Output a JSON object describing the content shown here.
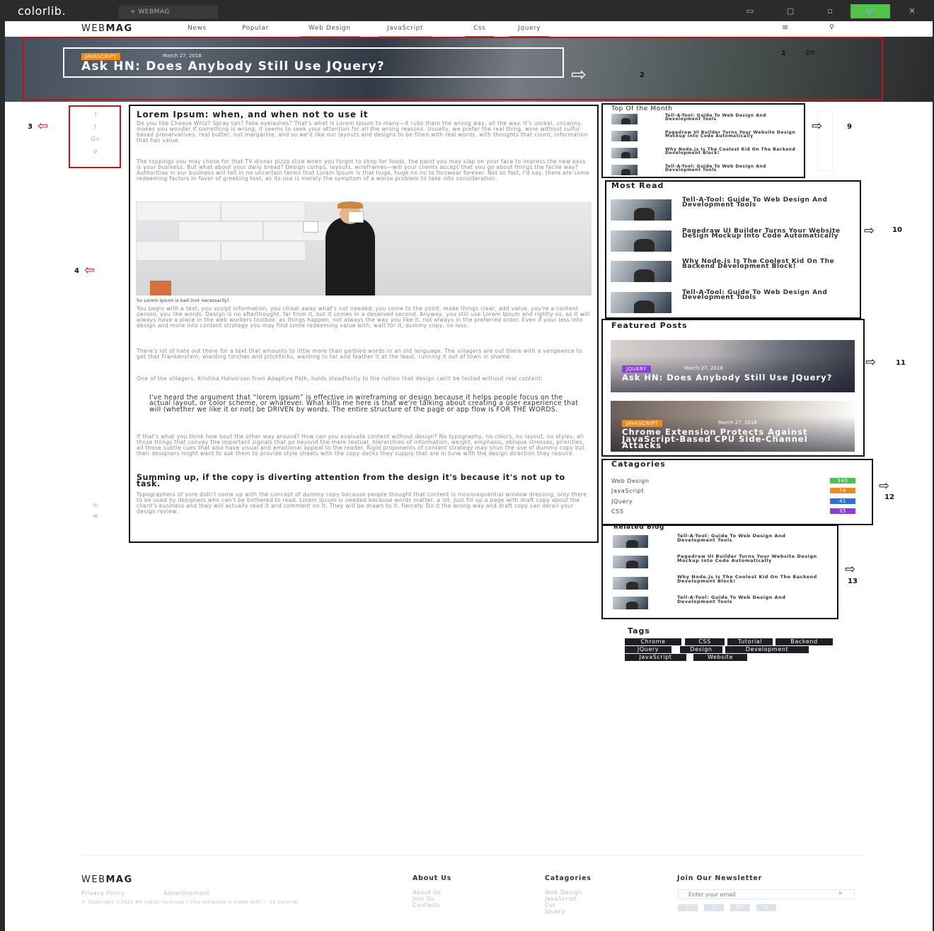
{
  "topbar": {
    "logo": "colorlib.",
    "template_tab": "+  WEBMAG"
  },
  "nav": {
    "brand_thin": "WEB",
    "brand_bold": "MAG",
    "items": [
      {
        "label": "News",
        "color": "#ffffff"
      },
      {
        "label": "Popular",
        "color": "#ffffff"
      },
      {
        "label": "Web Design",
        "color": "#4bbf5b"
      },
      {
        "label": "JavaScript",
        "color": "#f08a1c"
      },
      {
        "label": "Css",
        "color": "#8b3fd9"
      },
      {
        "label": "Jquery",
        "color": "#8b3fd9"
      }
    ]
  },
  "hero": {
    "badge": "JAVASCRIPT",
    "date": "March 27, 2018",
    "title": "Ask HN: Does Anybody Still Use JQuery?"
  },
  "callouts": [
    "1",
    "2",
    "3",
    "4",
    "9",
    "10",
    "11",
    "12",
    "13"
  ],
  "social_labels": [
    "f",
    "t",
    "G+",
    "p",
    "in",
    "✉"
  ],
  "article": {
    "title": "Lorem Ipsum: when, and when not to use it",
    "p1": "Do you like Cheese Whiz? Spray tan? Fake eyelashes? That's what is Lorem Ipsum to many—it rubs them the wrong way, all the way. It's unreal, uncanny, makes you wonder if something is wrong, it seems to seek your attention for all the wrong reasons. Usually, we prefer the real thing, wine without sulfur based preservatives, real butter, not margarine, and so we'd like our layouts and designs to be filled with real words, with thoughts that count, information that has value.",
    "p2": "The toppings you may chose for that TV dinner pizza slice when you forgot to shop for foods, the paint you may slap on your face to impress the new boss is your business. But what about your daily bread? Design comps, layouts, wireframes—will your clients accept that you go about things the facile way? Authorities in our business will tell in no uncertain terms that Lorem Ipsum is that huge, huge no no to forswear forever. Not so fast, I'd say, there are some redeeming factors in favor of greeking text, as its use is merely the symptom of a worse problem to take into consideration.",
    "caption": "So Lorem Ipsum is bad (not necessarily)",
    "p3": "You begin with a text, you sculpt information, you chisel away what's not needed, you come to the point, make things clear, add value, you're a content person, you like words. Design is no afterthought, far from it, but it comes in a deserved second. Anyway, you still use Lorem Ipsum and rightly so, as it will always have a place in the web workers toolbox, as things happen, not always the way you like it, not always in the preferred order. Even if your less into design and more into content strategy you may find some redeeming value with, wait for it, dummy copy, no less.",
    "p4": "There's lot of hate out there for a text that amounts to little more than garbled words in an old language. The villagers are out there with a vengeance to get that Frankenstein, wielding torches and pitchforks, wanting to tar and feather it at the least, running it out of town in shame.",
    "p5": "One of the villagers, Kristina Halvorson from Adaptive Path, holds steadfastly to the notion that design can't be tested without real content:",
    "quote": "I've heard the argument that “lorem ipsum” is effective in wireframing or design because it helps people focus on the actual layout, or color scheme, or whatever. What kills me here is that we're talking about creating a user experience that will (whether we like it or not) be DRIVEN by words. The entire structure of the page or app flow is FOR THE WORDS.",
    "p6": "If that's what you think how bout the other way around? How can you evaluate content without design? No typography, no colors, no layout, no styles, all those things that convey the important signals that go beyond the mere textual, hierarchies of information, weight, emphasis, oblique stresses, priorities, all those subtle cues that also have visual and emotional appeal to the reader. Rigid proponents of content strategy may shun the use of dummy copy but then designers might want to ask them to provide style sheets with the copy decks they supply that are in tune with the design direction they require.",
    "h2": "Summing up, if the copy is diverting attention from the design it's because it's not up to task.",
    "p7": "Typographers of yore didn't come up with the concept of dummy copy because people thought that content is inconsequential window dressing, only there to be used by designers who can't be bothered to read. Lorem Ipsum is needed because words matter, a lot. Just fill up a page with draft copy about the client's business and they will actually read it and comment on it. They will be drawn to it, fiercely. Do it the wrong way and draft copy can derail your design review."
  },
  "top_month": {
    "title": "Top Of the Month",
    "items": [
      "Tell-A-Tool: Guide To Web Design And Development Tools",
      "Pagedraw UI Builder Turns Your Website Design Mockup Into Code Automatically",
      "Why Node.js Is The Coolest Kid On The Backend Development Block!",
      "Tell-A-Tool: Guide To Web Design And Development Tools"
    ]
  },
  "most_read": {
    "title": "Most Read",
    "items": [
      "Tell-A-Tool: Guide To Web Design And Development Tools",
      "Pagedraw UI Builder Turns Your Website Design Mockup Into Code Automatically",
      "Why Node.js Is The Coolest Kid On The Backend Development Block!",
      "Tell-A-Tool: Guide To Web Design And Development Tools"
    ]
  },
  "featured": {
    "title": "Featured Posts",
    "posts": [
      {
        "badge": "JQUERY",
        "badge_color": "#8b3fd9",
        "date": "March 27, 2018",
        "title": "Ask HN: Does Anybody Still Use JQuery?"
      },
      {
        "badge": "JAVASCRIPT",
        "badge_color": "#f08a1c",
        "date": "March 27, 2018",
        "title": "Chrome Extension Protects Against JavaScript-Based CPU Side-Channel Attacks"
      }
    ]
  },
  "categories": {
    "title": "Catagories",
    "items": [
      {
        "name": "Web Design",
        "count": "340",
        "color": "#4bbf5b"
      },
      {
        "name": "JavaScript",
        "count": "74",
        "color": "#f08a1c"
      },
      {
        "name": "JQuery",
        "count": "41",
        "color": "#2f6fd6"
      },
      {
        "name": "CSS",
        "count": "35",
        "color": "#8b3fd9"
      }
    ]
  },
  "related": {
    "title": "Related Blog",
    "items": [
      "Tell-A-Tool: Guide To Web Design And Development Tools",
      "Pagedraw UI Builder Turns Your Website Design Mockup Into Code Automatically",
      "Why Node.js Is The Coolest Kid On The Backend Development Block!",
      "Tell-A-Tool: Guide To Web Design And Development Tools"
    ]
  },
  "tags": {
    "title": "Tags",
    "items": [
      "Chrome",
      "CSS",
      "Tutorial",
      "Backend",
      "JQuery",
      "Design",
      "Development",
      "JavaScript",
      "Website"
    ]
  },
  "footer": {
    "brand_thin": "WEB",
    "brand_bold": "MAG",
    "links": [
      "Privacy Policy",
      "Advertisement"
    ],
    "copyright": "© Copyright ©2022 All rights reserved | This template is made with ♡ by Colorlib",
    "about": {
      "title": "About Us",
      "links": [
        "About Us",
        "Join Us",
        "Contacts"
      ]
    },
    "cats": {
      "title": "Catagories",
      "links": [
        "Web Design",
        "JavaScript",
        "Css",
        "Jquery"
      ]
    },
    "newsletter": {
      "title": "Join Our Newsletter",
      "placeholder": "Enter your email"
    }
  }
}
